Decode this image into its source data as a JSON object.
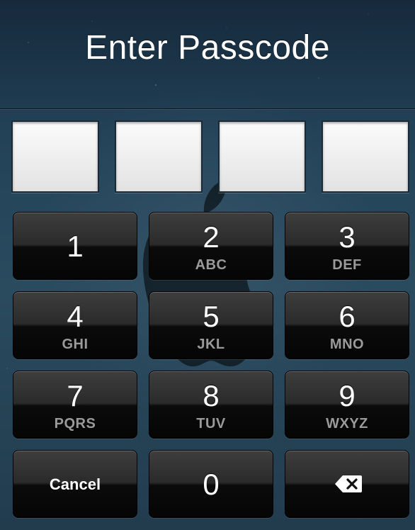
{
  "title": "Enter Passcode",
  "passcode": {
    "entered_count": 0,
    "length": 4
  },
  "keypad": {
    "rows": [
      [
        {
          "num": "1",
          "letters": ""
        },
        {
          "num": "2",
          "letters": "ABC"
        },
        {
          "num": "3",
          "letters": "DEF"
        }
      ],
      [
        {
          "num": "4",
          "letters": "GHI"
        },
        {
          "num": "5",
          "letters": "JKL"
        },
        {
          "num": "6",
          "letters": "MNO"
        }
      ],
      [
        {
          "num": "7",
          "letters": "PQRS"
        },
        {
          "num": "8",
          "letters": "TUV"
        },
        {
          "num": "9",
          "letters": "WXYZ"
        }
      ]
    ],
    "cancel_label": "Cancel",
    "zero": "0",
    "delete_icon": "backspace-icon"
  },
  "colors": {
    "background": "#24445a",
    "key_top": "#3e3e3e",
    "key_bottom": "#050505",
    "key_letters": "#9a9a9a"
  }
}
